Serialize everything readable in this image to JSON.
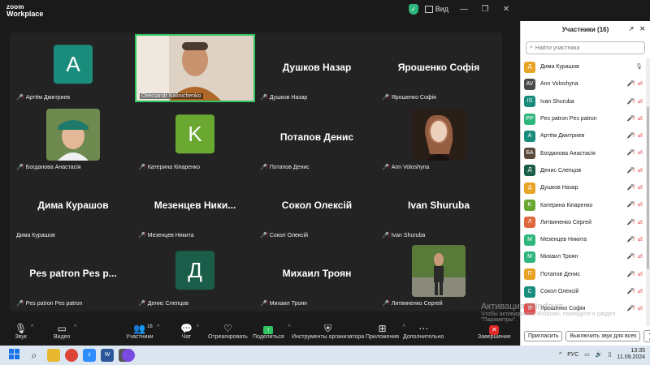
{
  "app": {
    "logo_line1": "zoom",
    "logo_line2": "Workplace",
    "view_label": "Вид"
  },
  "window_controls": {
    "minimize": "—",
    "maximize": "❐",
    "close": "✕"
  },
  "tiles": [
    {
      "type": "avatar",
      "letter": "A",
      "color": "#1a8c7c",
      "label": "Артём Дмитриев",
      "muted": true
    },
    {
      "type": "photo",
      "label": "Oleksandr Kalinichenko",
      "muted": false,
      "active": true
    },
    {
      "type": "name",
      "big": "Душков Назар",
      "label": "Душков Назар",
      "muted": true
    },
    {
      "type": "name",
      "big": "Ярошенко Софія",
      "label": "Ярошенко Софія",
      "muted": true
    },
    {
      "type": "photo",
      "label": "Богданова Анастасія",
      "muted": true
    },
    {
      "type": "avatar",
      "letter": "K",
      "color": "#6aa832",
      "label": "Катерина Кіпаренко",
      "muted": true
    },
    {
      "type": "name",
      "big": "Потапов Денис",
      "label": "Потапов Денис",
      "muted": true
    },
    {
      "type": "photo",
      "label": "Ann Voloshyna",
      "muted": true
    },
    {
      "type": "name",
      "big": "Дима Курашов",
      "label": "Дима Курашов",
      "muted": false
    },
    {
      "type": "name",
      "big": "Мезенцев  Ники...",
      "label": "Мезенцев Никита",
      "muted": true
    },
    {
      "type": "name",
      "big": "Сокол Олексій",
      "label": "Сокол Олексій",
      "muted": true
    },
    {
      "type": "name",
      "big": "Ivan Shuruba",
      "label": "Ivan Shuruba",
      "muted": true
    },
    {
      "type": "name",
      "big": "Pes patron Pes p...",
      "label": "Pes patron Pes patron",
      "muted": true
    },
    {
      "type": "avatar",
      "letter": "Д",
      "color": "#1a5e4a",
      "label": "Денис Слепцов",
      "muted": true
    },
    {
      "type": "name",
      "big": "Михаил Троян",
      "label": "Михаил Троян",
      "muted": true
    },
    {
      "type": "photo",
      "label": "Литвиненко Сергей",
      "muted": true
    }
  ],
  "toolbar": {
    "audio": "Звук",
    "video": "Видео",
    "participants": "Участники",
    "participants_count": "16",
    "chat": "Чат",
    "react": "Отреагировать",
    "share": "Поделиться",
    "host_tools": "Инструменты организатора",
    "apps": "Приложения",
    "more": "Дополнительно",
    "end": "Завершение"
  },
  "panel": {
    "title": "Участники (16)",
    "search_placeholder": "Найти участника",
    "invite": "Пригласить",
    "mute_all": "Выключить звук для всех",
    "more": "❯",
    "participants": [
      {
        "initials": "Д",
        "color": "#e8a324",
        "name": "Дима Курашов",
        "mic_on": true
      },
      {
        "initials": "AV",
        "color": "#4a4a4a",
        "name": "Ann Voloshyna",
        "mic_on": false
      },
      {
        "initials": "IS",
        "color": "#1a8c7c",
        "name": "Ivan Shuruba",
        "mic_on": false
      },
      {
        "initials": "PP",
        "color": "#2eb67d",
        "name": "Pes patron Pes patron",
        "mic_on": false
      },
      {
        "initials": "A",
        "color": "#1a8c7c",
        "name": "Артём Дмитриев",
        "mic_on": false
      },
      {
        "initials": "БА",
        "color": "#5a4a3a",
        "name": "Богданова Анастасія",
        "mic_on": false
      },
      {
        "initials": "Д",
        "color": "#1a5e4a",
        "name": "Денис Слепцов",
        "mic_on": false
      },
      {
        "initials": "Д",
        "color": "#e8a324",
        "name": "Душков Назар",
        "mic_on": false
      },
      {
        "initials": "K",
        "color": "#6aa832",
        "name": "Катерина Кіпаренко",
        "mic_on": false
      },
      {
        "initials": "Л",
        "color": "#e0683a",
        "name": "Литвиненко Сергей",
        "mic_on": false
      },
      {
        "initials": "М",
        "color": "#2eb67d",
        "name": "Мезенцев Никита",
        "mic_on": false
      },
      {
        "initials": "М",
        "color": "#2eb67d",
        "name": "Михаил Троян",
        "mic_on": false
      },
      {
        "initials": "П",
        "color": "#e8a324",
        "name": "Потапов Денис",
        "mic_on": false
      },
      {
        "initials": "С",
        "color": "#1a8c7c",
        "name": "Сокол Олексій",
        "mic_on": false
      },
      {
        "initials": "Я",
        "color": "#e05050",
        "name": "Ярошенко Софія",
        "mic_on": false
      }
    ]
  },
  "watermark": {
    "line1": "Активация Windows",
    "line2": "Чтобы активировать Windows, перейдите в раздел \"Параметры\"."
  },
  "taskbar": {
    "lang": "РУС",
    "time": "13:35",
    "date": "11.09.2024"
  },
  "colors": {
    "active_border": "#2ec45f",
    "mute_red": "#e02828",
    "share_green": "#2ec45f"
  }
}
